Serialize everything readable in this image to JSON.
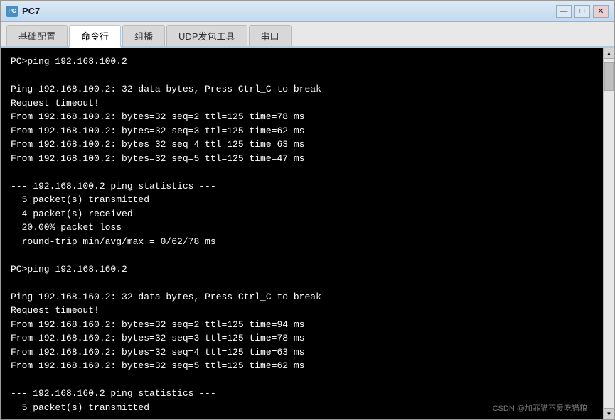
{
  "window": {
    "title": "PC7",
    "icon_label": "PC"
  },
  "title_buttons": {
    "minimize": "—",
    "maximize": "□",
    "close": "✕"
  },
  "tabs": [
    {
      "label": "基础配置",
      "active": false
    },
    {
      "label": "命令行",
      "active": true
    },
    {
      "label": "组播",
      "active": false
    },
    {
      "label": "UDP发包工具",
      "active": false
    },
    {
      "label": "串口",
      "active": false
    }
  ],
  "terminal_content": "PC>ping 192.168.100.2\n\nPing 192.168.100.2: 32 data bytes, Press Ctrl_C to break\nRequest timeout!\nFrom 192.168.100.2: bytes=32 seq=2 ttl=125 time=78 ms\nFrom 192.168.100.2: bytes=32 seq=3 ttl=125 time=62 ms\nFrom 192.168.100.2: bytes=32 seq=4 ttl=125 time=63 ms\nFrom 192.168.100.2: bytes=32 seq=5 ttl=125 time=47 ms\n\n--- 192.168.100.2 ping statistics ---\n  5 packet(s) transmitted\n  4 packet(s) received\n  20.00% packet loss\n  round-trip min/avg/max = 0/62/78 ms\n\nPC>ping 192.168.160.2\n\nPing 192.168.160.2: 32 data bytes, Press Ctrl_C to break\nRequest timeout!\nFrom 192.168.160.2: bytes=32 seq=2 ttl=125 time=94 ms\nFrom 192.168.160.2: bytes=32 seq=3 ttl=125 time=78 ms\nFrom 192.168.160.2: bytes=32 seq=4 ttl=125 time=63 ms\nFrom 192.168.160.2: bytes=32 seq=5 ttl=125 time=62 ms\n\n--- 192.168.160.2 ping statistics ---\n  5 packet(s) transmitted",
  "watermark": "CSDN @加菲猫不爱吃猫粮"
}
